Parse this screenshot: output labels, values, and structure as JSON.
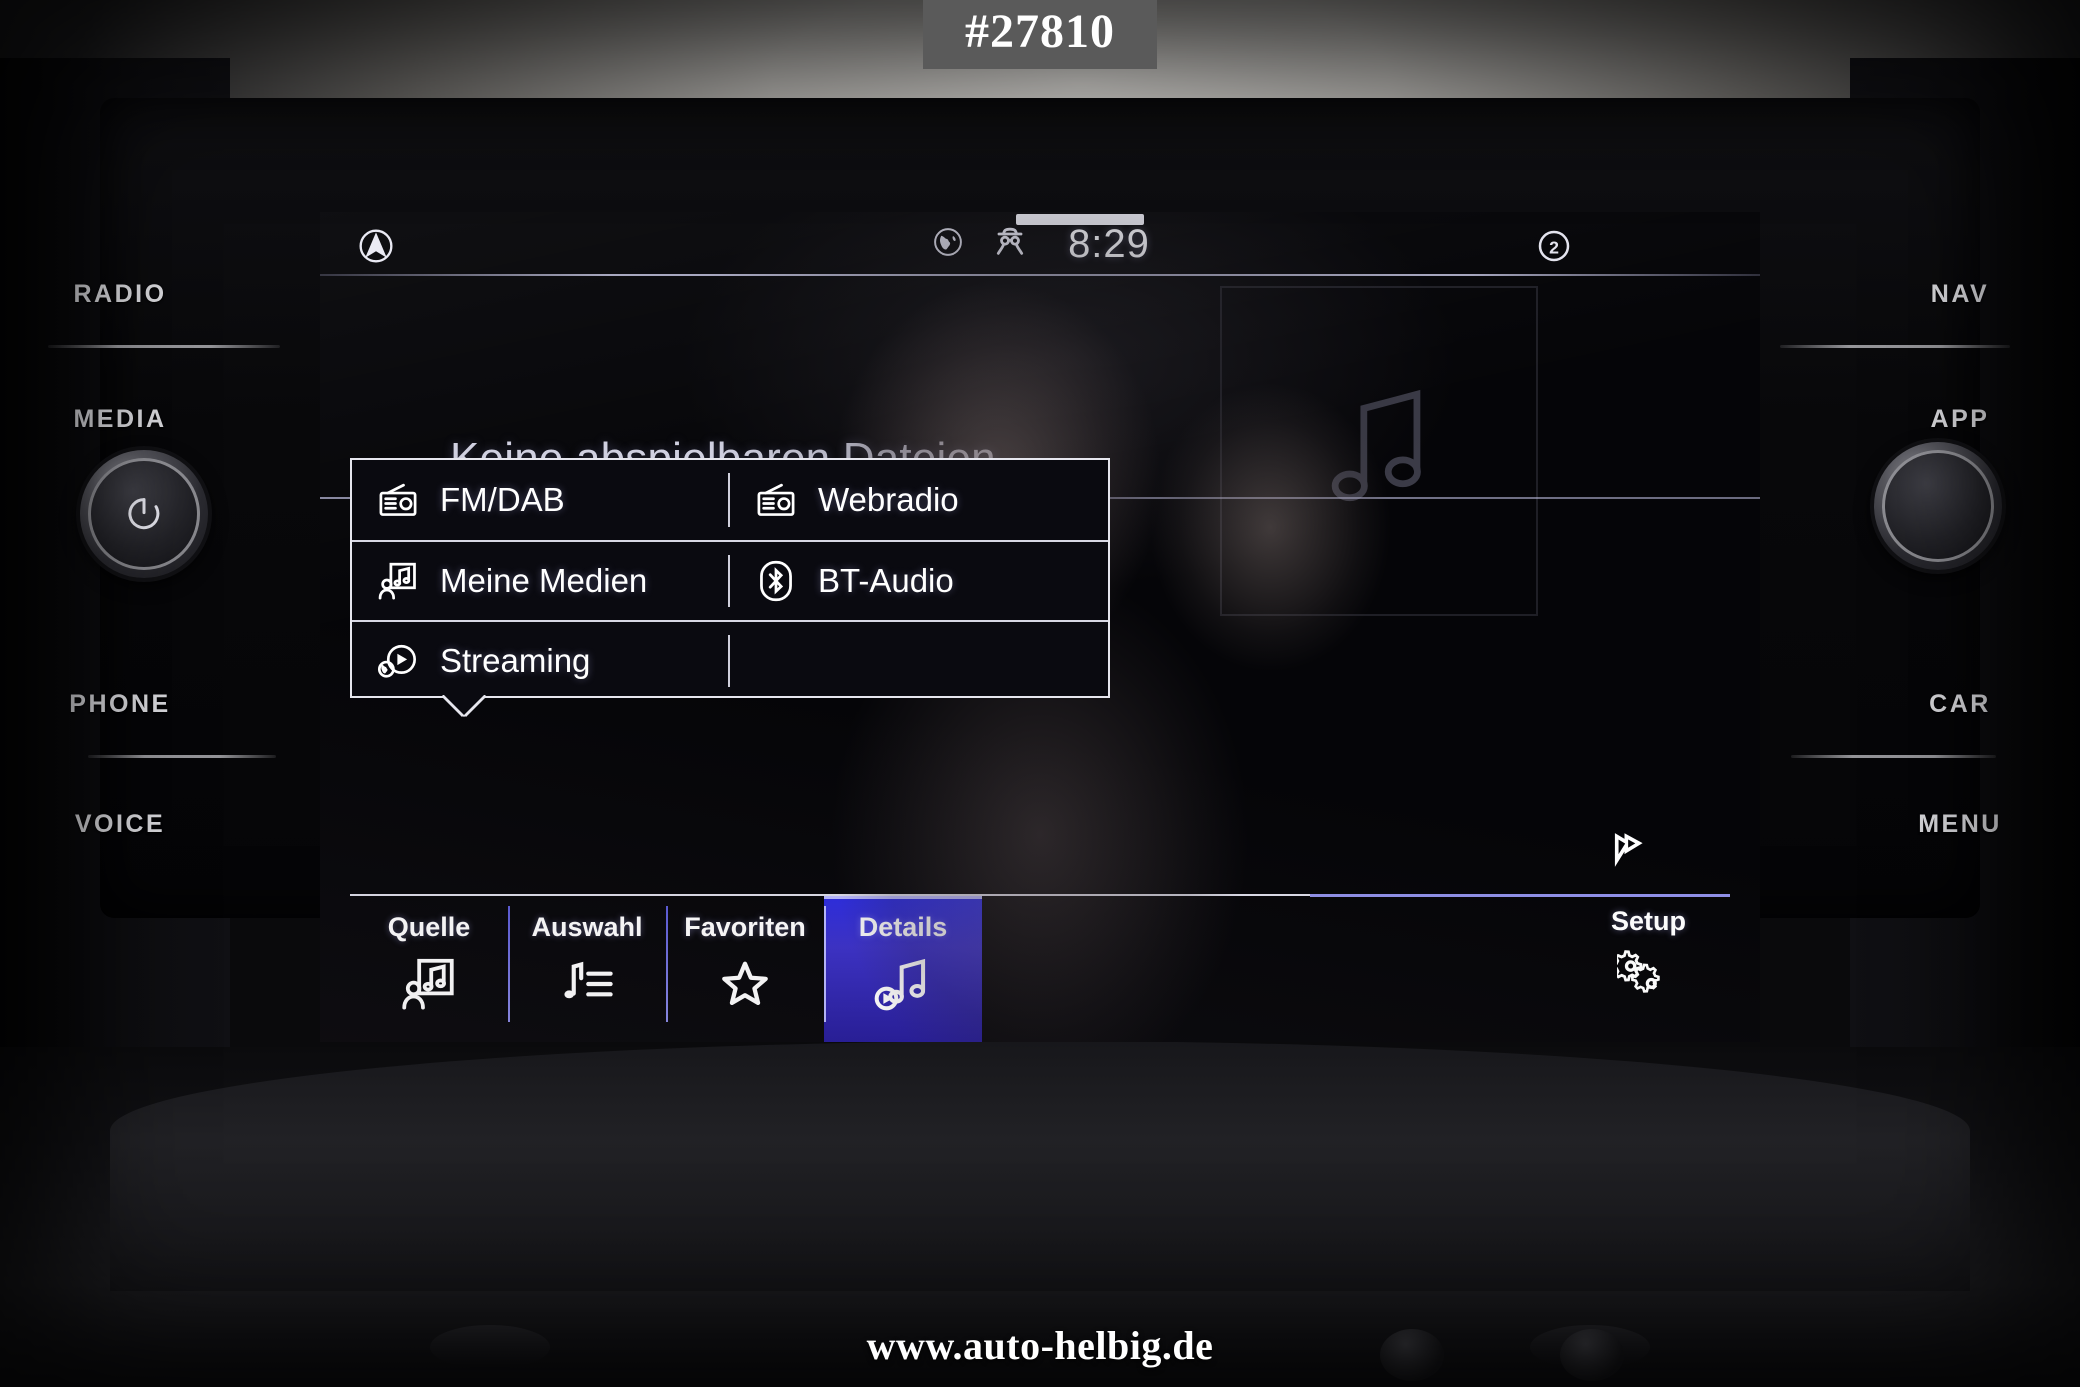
{
  "overlay": {
    "id_tag": "#27810",
    "watermark": "www.auto-helbig.de"
  },
  "hardware": {
    "left_buttons": [
      {
        "label": "RADIO",
        "name": "radio-button"
      },
      {
        "label": "MEDIA",
        "name": "media-button"
      },
      {
        "label": "PHONE",
        "name": "phone-button"
      },
      {
        "label": "VOICE",
        "name": "voice-button"
      }
    ],
    "right_buttons": [
      {
        "label": "NAV",
        "name": "nav-button"
      },
      {
        "label": "APP",
        "name": "app-button"
      },
      {
        "label": "CAR",
        "name": "car-button"
      },
      {
        "label": "MENU",
        "name": "menu-button"
      }
    ],
    "left_knob": "power-volume-knob",
    "right_knob": "tune-knob"
  },
  "screen": {
    "statusbar": {
      "nav_icon": "navigation-arrow-icon",
      "globe_icon": "globe-icon",
      "privacy_icon": "incognito-icon",
      "clock": "8:29",
      "profile_badge": "2"
    },
    "content": {
      "message": "Keine abspielbaren Dateien",
      "albumart_icon": "music-note-icon"
    },
    "source_popup": {
      "items": [
        {
          "label": "FM/DAB",
          "icon": "radio-icon",
          "column": "left",
          "row": 1
        },
        {
          "label": "Webradio",
          "icon": "radio-icon",
          "column": "right",
          "row": 1
        },
        {
          "label": "Meine Medien",
          "icon": "my-media-icon",
          "column": "left",
          "row": 2
        },
        {
          "label": "BT-Audio",
          "icon": "bluetooth-icon",
          "column": "right",
          "row": 2
        },
        {
          "label": "Streaming",
          "icon": "streaming-icon",
          "column": "left",
          "row": 3
        },
        {
          "label": "",
          "icon": "",
          "column": "right",
          "row": 3
        }
      ]
    },
    "tabs": [
      {
        "label": "Quelle",
        "icon": "my-media-icon",
        "active": false
      },
      {
        "label": "Auswahl",
        "icon": "playlist-icon",
        "active": false
      },
      {
        "label": "Favoriten",
        "icon": "star-icon",
        "active": false
      },
      {
        "label": "Details",
        "icon": "now-playing-icon",
        "active": true
      }
    ],
    "setup": {
      "label": "Setup",
      "icon": "gears-icon",
      "bookmark_icon": "bookmark-icon"
    },
    "colors": {
      "accent": "#2b2be0",
      "text": "#ffffff",
      "panel_border": "#e6e6ee",
      "background": "#050508"
    }
  }
}
